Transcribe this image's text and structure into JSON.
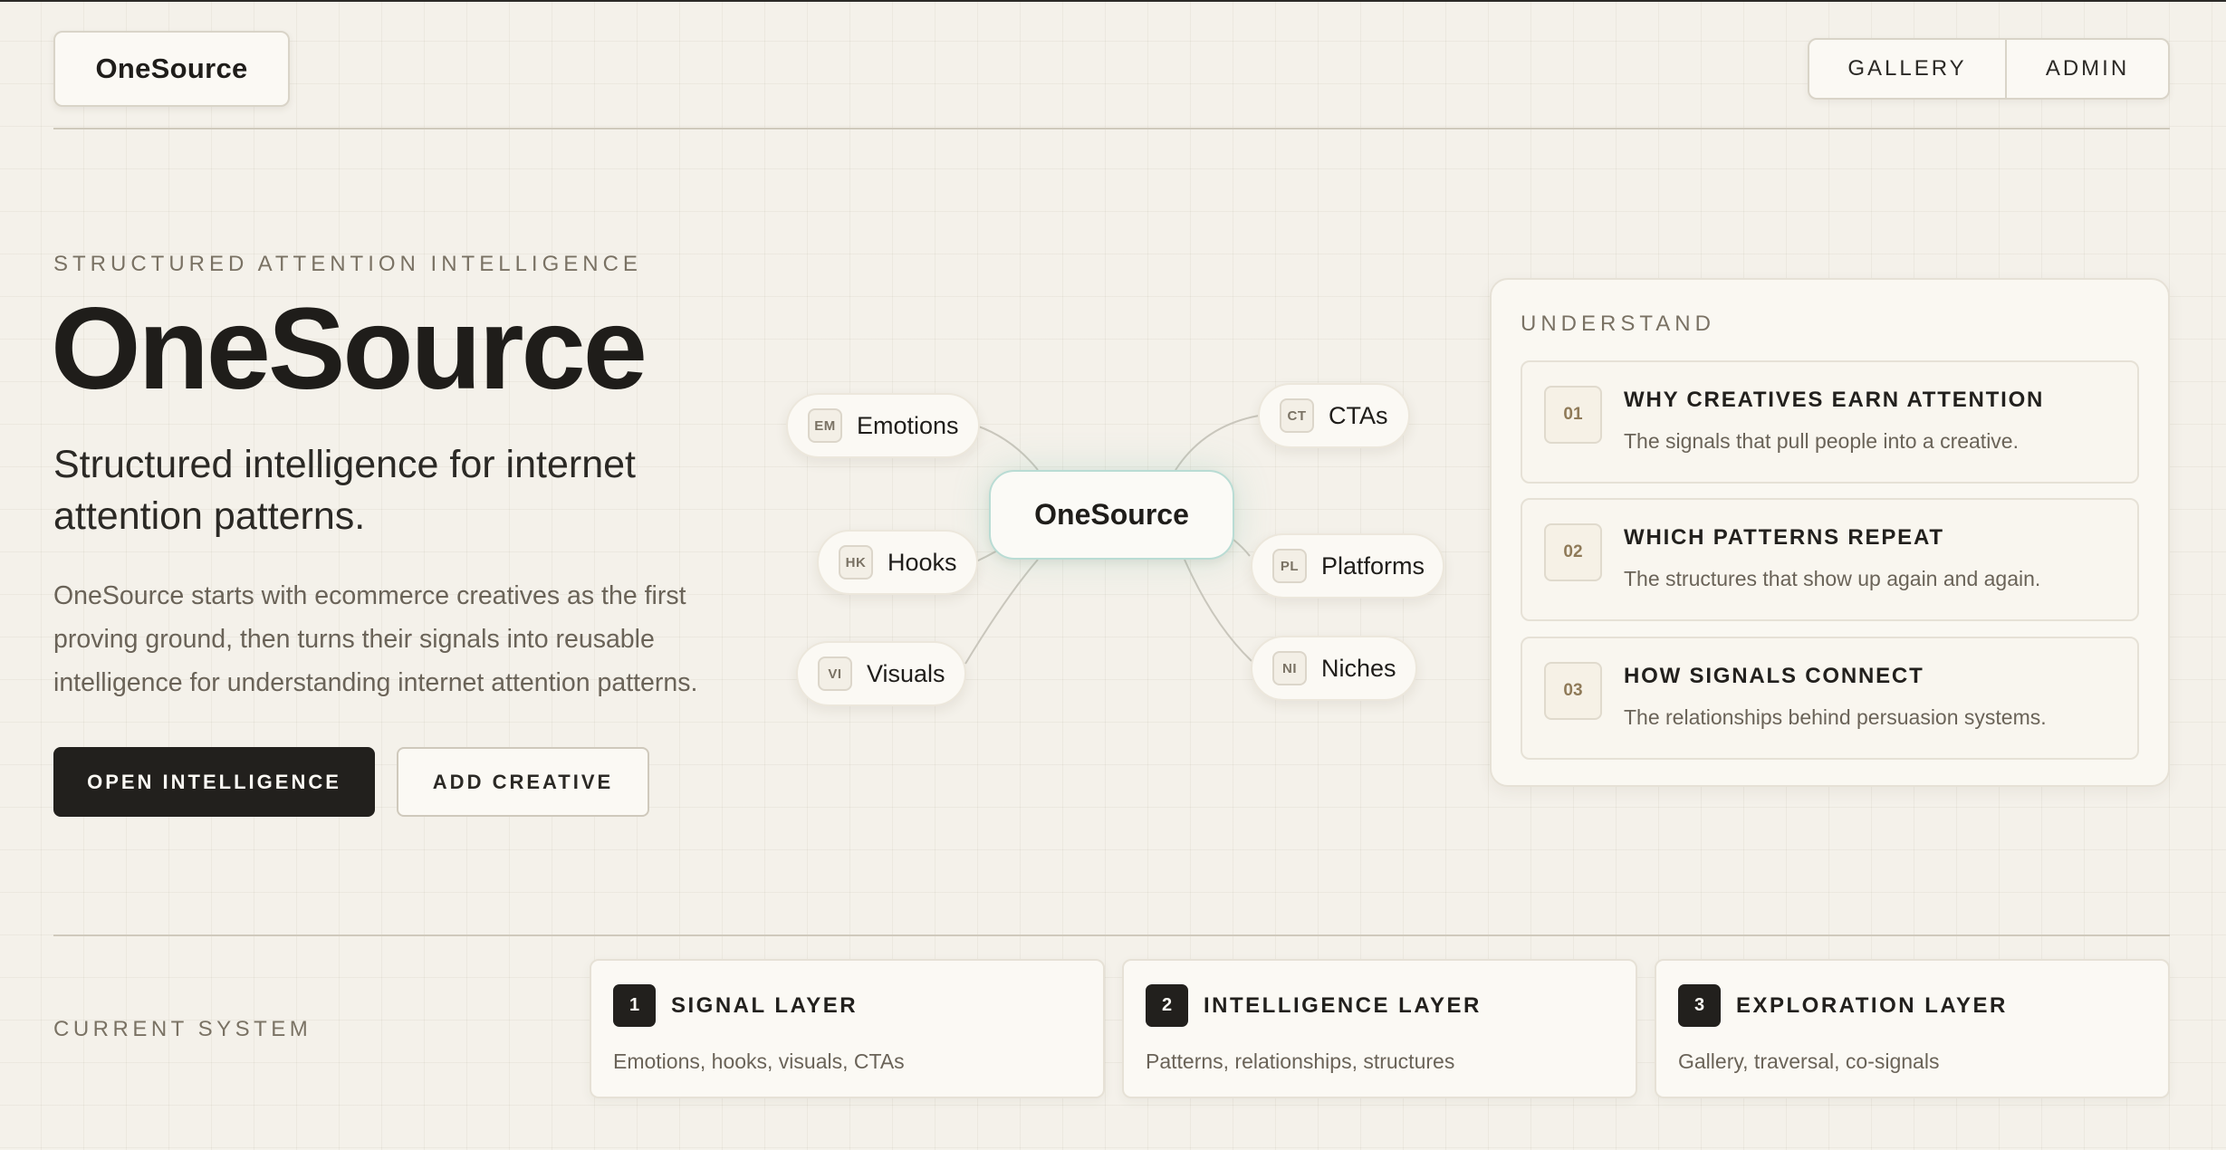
{
  "header": {
    "logo": "OneSource",
    "nav": [
      {
        "label": "GALLERY"
      },
      {
        "label": "ADMIN"
      }
    ]
  },
  "hero": {
    "eyebrow": "STRUCTURED ATTENTION INTELLIGENCE",
    "title": "OneSource",
    "subtitle": "Structured intelligence for internet attention patterns.",
    "body": "OneSource starts with ecommerce creatives as the first proving ground, then turns their signals into reusable intelligence for understanding internet attention patterns.",
    "primary_button": "OPEN INTELLIGENCE",
    "secondary_button": "ADD CREATIVE"
  },
  "graph": {
    "center": "OneSource",
    "nodes": [
      {
        "tag": "EM",
        "label": "Emotions"
      },
      {
        "tag": "CT",
        "label": "CTAs"
      },
      {
        "tag": "HK",
        "label": "Hooks"
      },
      {
        "tag": "PL",
        "label": "Platforms"
      },
      {
        "tag": "VI",
        "label": "Visuals"
      },
      {
        "tag": "NI",
        "label": "Niches"
      }
    ]
  },
  "understand": {
    "title": "UNDERSTAND",
    "cards": [
      {
        "num": "01",
        "title": "WHY CREATIVES EARN ATTENTION",
        "desc": "The signals that pull people into a creative."
      },
      {
        "num": "02",
        "title": "WHICH PATTERNS REPEAT",
        "desc": "The structures that show up again and again."
      },
      {
        "num": "03",
        "title": "HOW SIGNALS CONNECT",
        "desc": "The relationships behind persuasion systems."
      }
    ]
  },
  "current_system": {
    "label": "CURRENT SYSTEM",
    "layers": [
      {
        "num": "1",
        "title": "SIGNAL LAYER",
        "desc": "Emotions, hooks, visuals, CTAs"
      },
      {
        "num": "2",
        "title": "INTELLIGENCE LAYER",
        "desc": "Patterns, relationships, structures"
      },
      {
        "num": "3",
        "title": "EXPLORATION LAYER",
        "desc": "Gallery, traversal, co-signals"
      }
    ]
  }
}
